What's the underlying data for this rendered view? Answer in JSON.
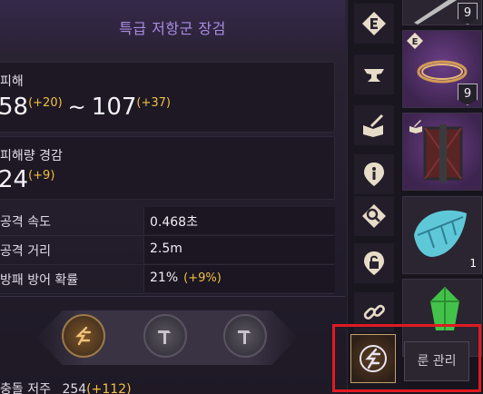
{
  "item": {
    "title": "특급 저항군 장검"
  },
  "damage": {
    "label": "피해",
    "min": "58",
    "min_bonus": "(+20)",
    "sep": "~",
    "max": "107",
    "max_bonus": "(+37)"
  },
  "reduction": {
    "label": "피해량 경감",
    "value": "24",
    "bonus": "(+9)"
  },
  "stats": [
    {
      "key": "공격 속도",
      "value": "0.468초",
      "bonus": ""
    },
    {
      "key": "공격 거리",
      "value": "2.5m",
      "bonus": ""
    },
    {
      "key": "방패 방어 확률",
      "value": "21%",
      "bonus": "(+9%)"
    }
  ],
  "runes": [
    {
      "state": "active",
      "icon": "rune-icon"
    },
    {
      "state": "empty",
      "icon": "hammer-icon"
    },
    {
      "state": "empty",
      "icon": "hammer-icon"
    }
  ],
  "bottom": {
    "label": "충돌 저주",
    "value": "254",
    "bonus": "(+112)"
  },
  "toolbar": [
    {
      "icon": "equip-e-icon"
    },
    {
      "icon": "anvil-icon"
    },
    {
      "icon": "book-sword-icon"
    },
    {
      "icon": "info-icon"
    },
    {
      "icon": "inspect-magnifier-icon"
    },
    {
      "icon": "lock-icon"
    },
    {
      "icon": "link-chain-icon"
    }
  ],
  "inventory": [
    {
      "kind": "sword",
      "level": "9"
    },
    {
      "kind": "bracelet",
      "level": "9",
      "marker": "E"
    },
    {
      "kind": "shield-book",
      "level": ""
    },
    {
      "kind": "leaf",
      "qty": "1"
    },
    {
      "kind": "green-crystal",
      "qty": ""
    }
  ],
  "rune_manage": {
    "label": "룬 관리"
  },
  "colors": {
    "accent_title": "#a98be2",
    "bonus": "#f0c040",
    "highlight": "#e01a22"
  }
}
